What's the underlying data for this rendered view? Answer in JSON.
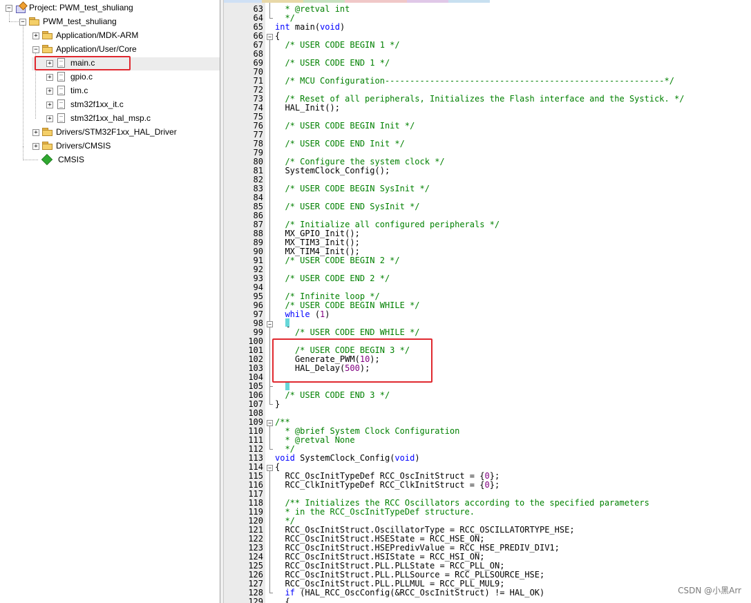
{
  "project_tree": {
    "root": "Project: PWM_test_shuliang",
    "target": "PWM_test_shuliang",
    "groups": [
      {
        "label": "Application/MDK-ARM",
        "icon": "folder-icon",
        "expanded": false
      },
      {
        "label": "Application/User/Core",
        "icon": "folder-icon",
        "expanded": true
      },
      {
        "label": "Drivers/STM32F1xx_HAL_Driver",
        "icon": "folder-icon",
        "expanded": false
      },
      {
        "label": "Drivers/CMSIS",
        "icon": "folder-icon",
        "expanded": false
      },
      {
        "label": "CMSIS",
        "icon": "cmsis-diamond-icon",
        "expanded": false
      }
    ],
    "files": [
      "main.c",
      "gpio.c",
      "tim.c",
      "stm32f1xx_it.c",
      "stm32f1xx_hal_msp.c"
    ]
  },
  "editor": {
    "lines": [
      {
        "n": "63",
        "t": "  * @retval int"
      },
      {
        "n": "64",
        "t": "  */"
      },
      {
        "n": "65",
        "t": "int main(void)"
      },
      {
        "n": "66",
        "t": "{"
      },
      {
        "n": "67",
        "t": "  /* USER CODE BEGIN 1 */"
      },
      {
        "n": "68",
        "t": ""
      },
      {
        "n": "69",
        "t": "  /* USER CODE END 1 */"
      },
      {
        "n": "70",
        "t": ""
      },
      {
        "n": "71",
        "t": "  /* MCU Configuration--------------------------------------------------------*/"
      },
      {
        "n": "72",
        "t": ""
      },
      {
        "n": "73",
        "t": "  /* Reset of all peripherals, Initializes the Flash interface and the Systick. */"
      },
      {
        "n": "74",
        "t": "  HAL_Init();"
      },
      {
        "n": "75",
        "t": ""
      },
      {
        "n": "76",
        "t": "  /* USER CODE BEGIN Init */"
      },
      {
        "n": "77",
        "t": ""
      },
      {
        "n": "78",
        "t": "  /* USER CODE END Init */"
      },
      {
        "n": "79",
        "t": ""
      },
      {
        "n": "80",
        "t": "  /* Configure the system clock */"
      },
      {
        "n": "81",
        "t": "  SystemClock_Config();"
      },
      {
        "n": "82",
        "t": ""
      },
      {
        "n": "83",
        "t": "  /* USER CODE BEGIN SysInit */"
      },
      {
        "n": "84",
        "t": ""
      },
      {
        "n": "85",
        "t": "  /* USER CODE END SysInit */"
      },
      {
        "n": "86",
        "t": ""
      },
      {
        "n": "87",
        "t": "  /* Initialize all configured peripherals */"
      },
      {
        "n": "88",
        "t": "  MX_GPIO_Init();"
      },
      {
        "n": "89",
        "t": "  MX_TIM3_Init();"
      },
      {
        "n": "90",
        "t": "  MX_TIM4_Init();"
      },
      {
        "n": "91",
        "t": "  /* USER CODE BEGIN 2 */"
      },
      {
        "n": "92",
        "t": ""
      },
      {
        "n": "93",
        "t": "  /* USER CODE END 2 */"
      },
      {
        "n": "94",
        "t": ""
      },
      {
        "n": "95",
        "t": "  /* Infinite loop */"
      },
      {
        "n": "96",
        "t": "  /* USER CODE BEGIN WHILE */"
      },
      {
        "n": "97",
        "t": "  while (1)"
      },
      {
        "n": "98",
        "t": "  {"
      },
      {
        "n": "99",
        "t": "    /* USER CODE END WHILE */"
      },
      {
        "n": "100",
        "t": ""
      },
      {
        "n": "101",
        "t": "    /* USER CODE BEGIN 3 */"
      },
      {
        "n": "102",
        "t": "    Generate_PWM(10);"
      },
      {
        "n": "103",
        "t": "    HAL_Delay(500);"
      },
      {
        "n": "104",
        "t": ""
      },
      {
        "n": "105",
        "t": "  }"
      },
      {
        "n": "106",
        "t": "  /* USER CODE END 3 */"
      },
      {
        "n": "107",
        "t": "}"
      },
      {
        "n": "108",
        "t": ""
      },
      {
        "n": "109",
        "t": "/**"
      },
      {
        "n": "110",
        "t": "  * @brief System Clock Configuration"
      },
      {
        "n": "111",
        "t": "  * @retval None"
      },
      {
        "n": "112",
        "t": "  */"
      },
      {
        "n": "113",
        "t": "void SystemClock_Config(void)"
      },
      {
        "n": "114",
        "t": "{"
      },
      {
        "n": "115",
        "t": "  RCC_OscInitTypeDef RCC_OscInitStruct = {0};"
      },
      {
        "n": "116",
        "t": "  RCC_ClkInitTypeDef RCC_ClkInitStruct = {0};"
      },
      {
        "n": "117",
        "t": ""
      },
      {
        "n": "118",
        "t": "  /** Initializes the RCC Oscillators according to the specified parameters"
      },
      {
        "n": "119",
        "t": "  * in the RCC_OscInitTypeDef structure."
      },
      {
        "n": "120",
        "t": "  */"
      },
      {
        "n": "121",
        "t": "  RCC_OscInitStruct.OscillatorType = RCC_OSCILLATORTYPE_HSE;"
      },
      {
        "n": "122",
        "t": "  RCC_OscInitStruct.HSEState = RCC_HSE_ON;"
      },
      {
        "n": "123",
        "t": "  RCC_OscInitStruct.HSEPredivValue = RCC_HSE_PREDIV_DIV1;"
      },
      {
        "n": "124",
        "t": "  RCC_OscInitStruct.HSIState = RCC_HSI_ON;"
      },
      {
        "n": "125",
        "t": "  RCC_OscInitStruct.PLL.PLLState = RCC_PLL_ON;"
      },
      {
        "n": "126",
        "t": "  RCC_OscInitStruct.PLL.PLLSource = RCC_PLLSOURCE_HSE;"
      },
      {
        "n": "127",
        "t": "  RCC_OscInitStruct.PLL.PLLMUL = RCC_PLL_MUL9;"
      },
      {
        "n": "128",
        "t": "  if (HAL_RCC_OscConfig(&RCC_OscInitStruct) != HAL_OK)"
      },
      {
        "n": "129",
        "t": "  {"
      }
    ]
  },
  "watermark": "CSDN @小黑Arr",
  "colors": {
    "comment": "#008000",
    "keyword": "#0000ff",
    "number": "#800080",
    "annotation_box": "#e0282f",
    "brace_match": "#66d7d9",
    "gutter": "#ebebeb"
  }
}
